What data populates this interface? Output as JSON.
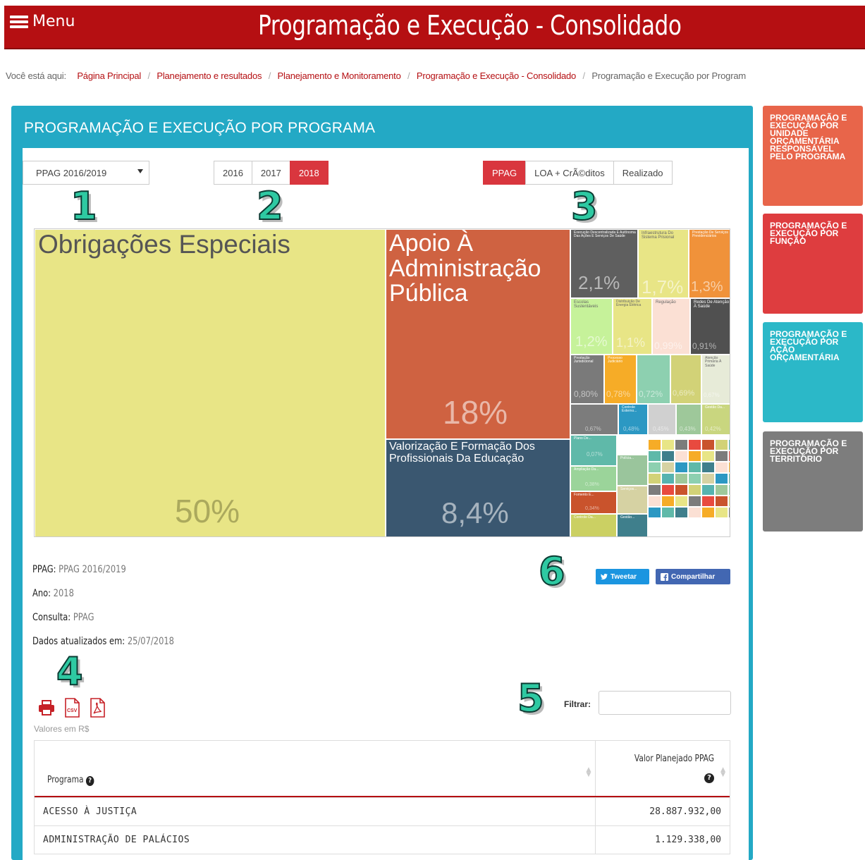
{
  "header": {
    "menu_label": "Menu",
    "title": "Programação e Execução - Consolidado"
  },
  "breadcrumb": {
    "prefix": "Você está aqui:",
    "items": [
      "Página Principal",
      "Planejamento e resultados",
      "Planejamento e Monitoramento",
      "Programação e Execução - Consolidado"
    ],
    "current": "Programação e Execução por Program"
  },
  "panel": {
    "title": "PROGRAMAÇÃO E EXECUÇÃO POR PROGRAMA"
  },
  "controls": {
    "ppag_select": "PPAG 2016/2019",
    "years": [
      "2016",
      "2017",
      "2018"
    ],
    "selected_year": "2018",
    "views": [
      "PPAG",
      "LOA + CrÃ©ditos",
      "Realizado"
    ],
    "selected_view": "PPAG"
  },
  "annotations": [
    "1",
    "2",
    "3",
    "4",
    "5",
    "6"
  ],
  "treemap": {
    "tiles": [
      {
        "name": "Obrigações Especiais",
        "pct": "50%",
        "color": "#e8e586"
      },
      {
        "name": "Apoio À Administração Pública",
        "pct": "18%",
        "color": "#cf6241"
      },
      {
        "name": "Valorização E Formação Dos Profissionais Da Educação",
        "pct": "8,4%",
        "color": "#3a5770"
      },
      {
        "name": "Execução Descentralizada E Autônoma Das Ações E Serviços De Saúde",
        "pct": "2,1%",
        "color": "#5f5f5f"
      },
      {
        "name": "Infraestrutura Do Sistema Prisional",
        "pct": "1,7%",
        "color": "#e8e586"
      },
      {
        "name": "Prestação De Serviços Previdenciários",
        "pct": "1,3%",
        "color": "#f0923a"
      },
      {
        "name": "Escolas Sustentáveis",
        "pct": "1,2%",
        "color": "#c6f29a"
      },
      {
        "name": "Distribuição De Energia Elétrica",
        "pct": "1,1%",
        "color": "#e8e586"
      },
      {
        "name": "Regulação",
        "pct": "0,99%",
        "color": "#fbe0d4"
      },
      {
        "name": "Redes De Atenção À Saúde",
        "pct": "0,91%",
        "color": "#505050"
      },
      {
        "name": "Prestação Jurisdicional",
        "pct": "0,80%",
        "color": "#7a7a7a"
      },
      {
        "name": "Processo Judiciário",
        "pct": "0,78%",
        "color": "#f6ac27"
      },
      {
        "name": "",
        "pct": "0,72%",
        "color": "#8dd0b0"
      },
      {
        "name": "",
        "pct": "0,69%",
        "color": "#d2d277"
      },
      {
        "name": "Atenção Primária À Saúde",
        "pct": "0,67%",
        "color": "#e7ebd8"
      },
      {
        "name": "",
        "pct": "0,67%",
        "color": "#7c7c7c"
      },
      {
        "name": "Controle Externo...",
        "pct": "0,48%",
        "color": "#2c98c3"
      },
      {
        "name": "",
        "pct": "0,45%",
        "color": "#d0d0d0"
      },
      {
        "name": "",
        "pct": "0,43%",
        "color": "#9ec89a"
      },
      {
        "name": "Gestão Da...",
        "pct": "0,42%",
        "color": "#c9d67f"
      },
      {
        "name": "Plano De...",
        "pct": "0,07%",
        "color": "#5fb9a9"
      },
      {
        "name": "Ampliação Da...",
        "pct": "0,38%",
        "color": "#9bd49a"
      },
      {
        "name": "Fomento E...",
        "pct": "0,34%",
        "color": "#c9532c"
      },
      {
        "name": "Controle Da...",
        "pct": "",
        "color": "#cbd063"
      },
      {
        "name": "Polícia...",
        "pct": "",
        "color": "#9ac59c"
      },
      {
        "name": "Serviços...",
        "pct": "",
        "color": "#d6d2a3"
      },
      {
        "name": "Gestão...",
        "pct": "",
        "color": "#3f7f8c"
      }
    ]
  },
  "info": {
    "ppag_label": "PPAG:",
    "ppag_value": "PPAG 2016/2019",
    "ano_label": "Ano:",
    "ano_value": "2018",
    "consulta_label": "Consulta:",
    "consulta_value": "PPAG",
    "updated_label": "Dados atualizados em:",
    "updated_value": "25/07/2018"
  },
  "share": {
    "tweet": "Tweetar",
    "facebook": "Compartilhar"
  },
  "exports": {
    "icons": [
      "print-icon",
      "csv-icon",
      "pdf-icon"
    ],
    "csv_text": "CSV",
    "values_label": "Valores em R$"
  },
  "filter": {
    "label": "Filtrar:",
    "value": ""
  },
  "table": {
    "columns": [
      "Programa",
      "Valor Planejado PPAG"
    ],
    "rows": [
      [
        "ACESSO À JUSTIÇA",
        "28.887.932,00"
      ],
      [
        "ADMINISTRAÇÃO DE PALÁCIOS",
        "1.129.338,00"
      ]
    ]
  },
  "sidebar": {
    "cards": [
      "PROGRAMAÇÃO E EXECUÇÃO POR UNIDADE ORÇAMENTÁRIA RESPONSÁVEL PELO PROGRAMA",
      "PROGRAMAÇÃO E EXECUÇÃO POR FUNÇÃO",
      "PROGRAMAÇÃO E EXECUÇÃO POR AÇÃO ORÇAMENTÁRIA",
      "PROGRAMAÇÃO E EXECUÇÃO POR TERRITÓRIO"
    ]
  }
}
